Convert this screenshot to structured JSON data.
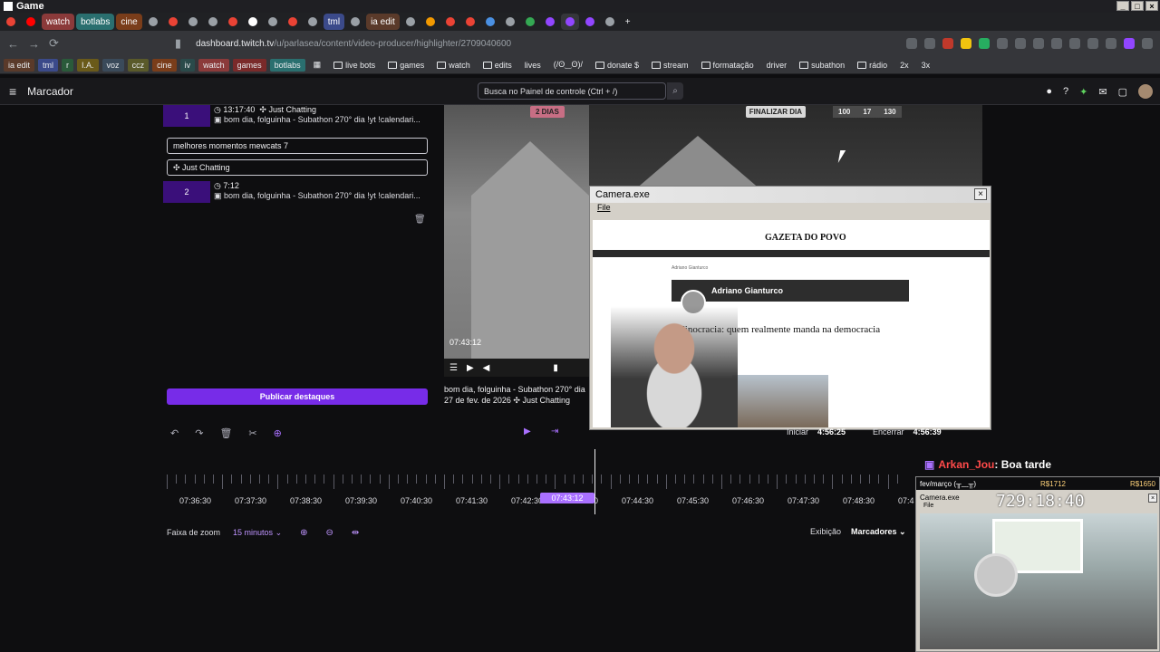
{
  "window": {
    "title": "Game"
  },
  "tabs": [
    {
      "label": "",
      "color": "#ea4335"
    },
    {
      "label": "",
      "color": "#ff0000"
    },
    {
      "label": "watch",
      "color": "#8b3a3a"
    },
    {
      "label": "botlabs",
      "color": "#2a6f6f"
    },
    {
      "label": "cine",
      "color": "#7a3d1a"
    },
    {
      "label": "tml",
      "color": "#3b4a8a"
    },
    {
      "label": "ia edit",
      "color": "#5a3a2a"
    }
  ],
  "address": {
    "host": "dashboard.twitch.tv",
    "path": "/u/parlasea/content/video-producer/highlighter/2709040600"
  },
  "bookmarks": [
    "ia edit",
    "tml",
    "r",
    "I.A.",
    "voz",
    "ccz",
    "cine",
    "iv",
    "watch",
    "games",
    "botlabs",
    "live bots",
    "games",
    "watch",
    "edits",
    "lives",
    "(/ʘ‿ʘ)/",
    "donate $",
    "stream",
    "formatação",
    "driver",
    "subathon",
    "rádio",
    "2x",
    "3x"
  ],
  "header": {
    "menu_label": "Marcador",
    "search_placeholder": "Busca no Painel de controle (Ctrl + /)"
  },
  "clips": [
    {
      "num": "1",
      "time": "13:17:40",
      "category": "Just Chatting",
      "title": "bom dia, folguinha - Subathon 270° dia !yt !calendari..."
    },
    {
      "num": "2",
      "time": "7:12",
      "title": "bom dia, folguinha - Subathon 270° dia !yt !calendari..."
    }
  ],
  "editor": {
    "title_value": "melhores momentos mewcats 7",
    "category_value": "Just Chatting",
    "publish_label": "Publicar destaques"
  },
  "video": {
    "timestamp": "07:43:12",
    "caption_line1": "bom dia, folguinha - Subathon 270° dia",
    "caption_date": "27 de fev. de 2026",
    "caption_category": "Just Chatting",
    "game_days": "2 DIAS",
    "game_button": "FINALIZAR DIA",
    "counter_a": "100",
    "counter_b": "17",
    "counter_c": "130"
  },
  "camera_window": {
    "title": "Camera.exe",
    "menu": "File",
    "site_logo": "GAZETA DO POVO",
    "breadcrumb": "Adriano Gianturco",
    "author": "Adriano Gianturco",
    "headline": "Minocracia: quem realmente manda na democracia"
  },
  "timeline": {
    "start_label": "Iniciar",
    "start_time": "4:56:25",
    "end_label": "Encerrar",
    "end_time": "4:56:39",
    "ticks": [
      "07:36:30",
      "07:37:30",
      "07:38:30",
      "07:39:30",
      "07:40:30",
      "07:41:30",
      "07:42:30",
      "07:43:30",
      "07:44:30",
      "07:45:30",
      "07:46:30",
      "07:47:30",
      "07:48:30",
      "07:4"
    ],
    "marker_time": "07:43:12"
  },
  "zoom": {
    "label": "Faixa de zoom",
    "value": "15 minutos",
    "display_label": "Exibição",
    "display_value": "Marcadores"
  },
  "chat": {
    "user": "Arkan_Jou",
    "message": ": Boa tarde"
  },
  "overlay": {
    "date_text": "fev/março (╥﹏╥)",
    "money_a": "R$1712",
    "money_b": "R$1650",
    "clock": "729:18:40",
    "title": "Camera.exe",
    "file": "File"
  }
}
